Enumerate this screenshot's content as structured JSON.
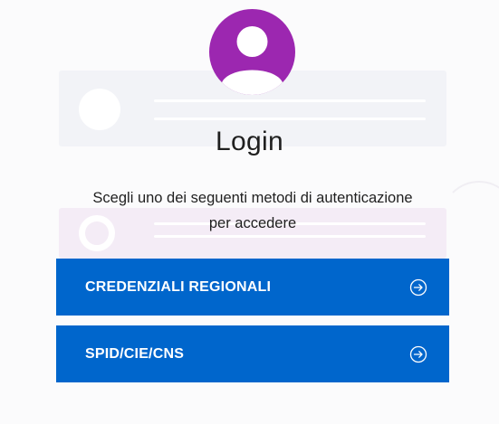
{
  "login": {
    "title": "Login",
    "subtitle_line1": "Scegli uno dei seguenti metodi di autenticazione",
    "subtitle_line2": "per accedere",
    "avatar_icon": "user-avatar-icon",
    "avatar_color": "#9c27b0",
    "methods": [
      {
        "label": "CREDENZIALI REGIONALI",
        "icon": "arrow-right-circle-icon"
      },
      {
        "label": "SPID/CIE/CNS",
        "icon": "arrow-right-circle-icon"
      }
    ],
    "button_color": "#0066cc"
  }
}
